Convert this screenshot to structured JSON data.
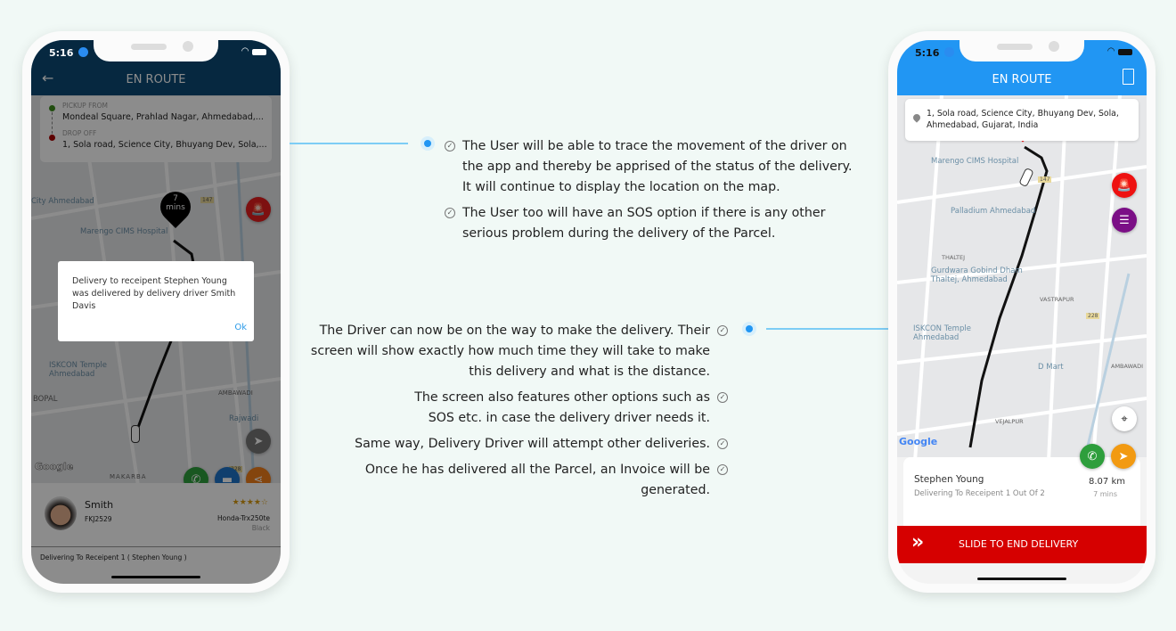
{
  "left_phone": {
    "status_time": "5:16",
    "header_title": "EN ROUTE",
    "pickup_label": "PICKUP FROM",
    "pickup_address": "Mondeal Square, Prahlad Nagar, Ahmedabad,...",
    "dropoff_label": "DROP OFF",
    "dropoff_address": "1, Sola road, Science City, Bhuyang Dev, Sola,...",
    "eta_pin": "7 mins",
    "map_labels": [
      "City Ahmedabad",
      "Marengo CIMS Hospital",
      "ISKCON Temple Ahmedabad",
      "BOPAL",
      "AMBAWADI",
      "Rajwadi",
      "147",
      "228",
      "MAKARBA"
    ],
    "dialog_message": "Delivery to receipent Stephen Young was delivered by delivery driver Smith Davis",
    "dialog_ok": "Ok",
    "driver_name": "Smith",
    "driver_plate": "FKJ2529",
    "rating": 4.5,
    "vehicle_model": "Honda-Trx250te",
    "vehicle_color": "Black",
    "footer_status": "Delivering To Receipent 1 ( Stephen Young )",
    "header_color": "#0b4a75"
  },
  "right_phone": {
    "status_time": "5:16",
    "header_title": "EN ROUTE",
    "address": "1, Sola road, Science City, Bhuyang Dev, Sola, Ahmedabad, Gujarat, India",
    "map_labels": [
      "Marengo CIMS Hospital",
      "Palladium Ahmedabad",
      "THALTEJ",
      "Gurdwara Gobind Dham Thaltej, Ahmedabad",
      "VASTRAPUR",
      "ISKCON Temple Ahmedabad",
      "D Mart",
      "AMBAWADI",
      "VEJALPUR",
      "147",
      "228",
      "Google"
    ],
    "recipient_name": "Stephen Young",
    "recipient_status": "Delivering To Receipent 1 Out Of 2",
    "distance": "8.07 km",
    "duration": "7 mins",
    "slide_label": "SLIDE TO END DELIVERY",
    "header_color": "#2196f3",
    "slide_color": "#d60000"
  },
  "descriptions": {
    "top": [
      "The User will be able to trace the movement of the driver on the app and thereby be apprised of the status of the delivery. It will continue to display the location on the map.",
      "The User too will have an SOS option if there is any other serious problem during the delivery of the Parcel."
    ],
    "bottom": [
      "The Driver can now be on the way to make the delivery. Their screen will show exactly how much time they will take to make this delivery and what is the distance.",
      "The screen also features other options such as SOS etc. in case the delivery driver needs it.",
      "Same way, Delivery Driver will attempt other deliveries.",
      "Once he has delivered all the Parcel, an Invoice will be generated."
    ]
  }
}
